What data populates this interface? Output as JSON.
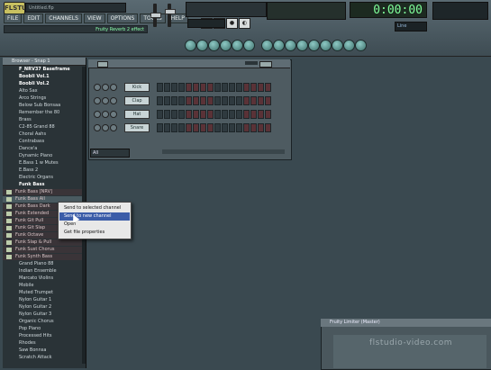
{
  "app": {
    "logo": "FLSTUDIO",
    "song_title": "Untitled.flp"
  },
  "menubar": [
    "FILE",
    "EDIT",
    "CHANNELS",
    "VIEW",
    "OPTIONS",
    "TOOLS",
    "HELP"
  ],
  "hint": "Fruity Reverb 2 effect",
  "clock": "0:00:00",
  "line_select": "Line",
  "browser": {
    "header": "Browser - Snap 1",
    "items": [
      {
        "label": "F_NRV37 Baseframe",
        "style": "bold"
      },
      {
        "label": "Boobli Vol.1",
        "style": "bold"
      },
      {
        "label": "Boobli Vol.2",
        "style": "bold"
      },
      {
        "label": "Alto Sax",
        "style": "normal"
      },
      {
        "label": "Arco Strings",
        "style": "normal"
      },
      {
        "label": "Below Sub Bonsaa",
        "style": "normal"
      },
      {
        "label": "Remember the 80",
        "style": "normal"
      },
      {
        "label": "Brass",
        "style": "normal"
      },
      {
        "label": "C2-85 Grand 88",
        "style": "normal"
      },
      {
        "label": "Choral Aahs",
        "style": "normal"
      },
      {
        "label": "Contrabass",
        "style": "normal"
      },
      {
        "label": "Dance'a",
        "style": "normal"
      },
      {
        "label": "Dynamic Piano",
        "style": "normal"
      },
      {
        "label": "E.Bass 1 w Mutes",
        "style": "normal"
      },
      {
        "label": "E.Bass 2",
        "style": "normal"
      },
      {
        "label": "Electric Organs",
        "style": "normal"
      },
      {
        "label": "Funk Bass",
        "style": "bold"
      },
      {
        "label": "Funk Bass [NRV]",
        "style": "sub"
      },
      {
        "label": "Funk Bass All",
        "style": "sub"
      },
      {
        "label": "Funk Bass Dark",
        "style": "sub"
      },
      {
        "label": "Funk Extended",
        "style": "sub"
      },
      {
        "label": "Funk Git Pull",
        "style": "sub"
      },
      {
        "label": "Funk Git Slap",
        "style": "sub"
      },
      {
        "label": "Funk Octave",
        "style": "sub"
      },
      {
        "label": "Funk Slap & Pull",
        "style": "sub"
      },
      {
        "label": "Funk Sust Chorus",
        "style": "sub"
      },
      {
        "label": "Funk Synth Bass",
        "style": "sub"
      },
      {
        "label": "Grand Piano 88",
        "style": "normal"
      },
      {
        "label": "Indian Ensemble",
        "style": "normal"
      },
      {
        "label": "Marcato Violins",
        "style": "normal"
      },
      {
        "label": "Mobile",
        "style": "normal"
      },
      {
        "label": "Muted Trumpet",
        "style": "normal"
      },
      {
        "label": "Nylon Guitar 1",
        "style": "normal"
      },
      {
        "label": "Nylon Guitar 2",
        "style": "normal"
      },
      {
        "label": "Nylon Guitar 3",
        "style": "normal"
      },
      {
        "label": "Organic Chorus",
        "style": "normal"
      },
      {
        "label": "Pop Piano",
        "style": "normal"
      },
      {
        "label": "Processed Hits",
        "style": "normal"
      },
      {
        "label": "Rhodes",
        "style": "normal"
      },
      {
        "label": "Saw Bonnsa",
        "style": "normal"
      },
      {
        "label": "Scratch Attack",
        "style": "normal"
      }
    ]
  },
  "rack": {
    "channels": [
      "Kick",
      "Clap",
      "Hat",
      "Snare"
    ],
    "filter": "All"
  },
  "context_menu": {
    "items": [
      "Send to selected channel",
      "Send to new channel",
      "Open",
      "Get file properties"
    ],
    "selected_index": 1
  },
  "playlist": {
    "title": "Fruity Limiter (Master)",
    "watermark": "flstudio-video.com"
  }
}
